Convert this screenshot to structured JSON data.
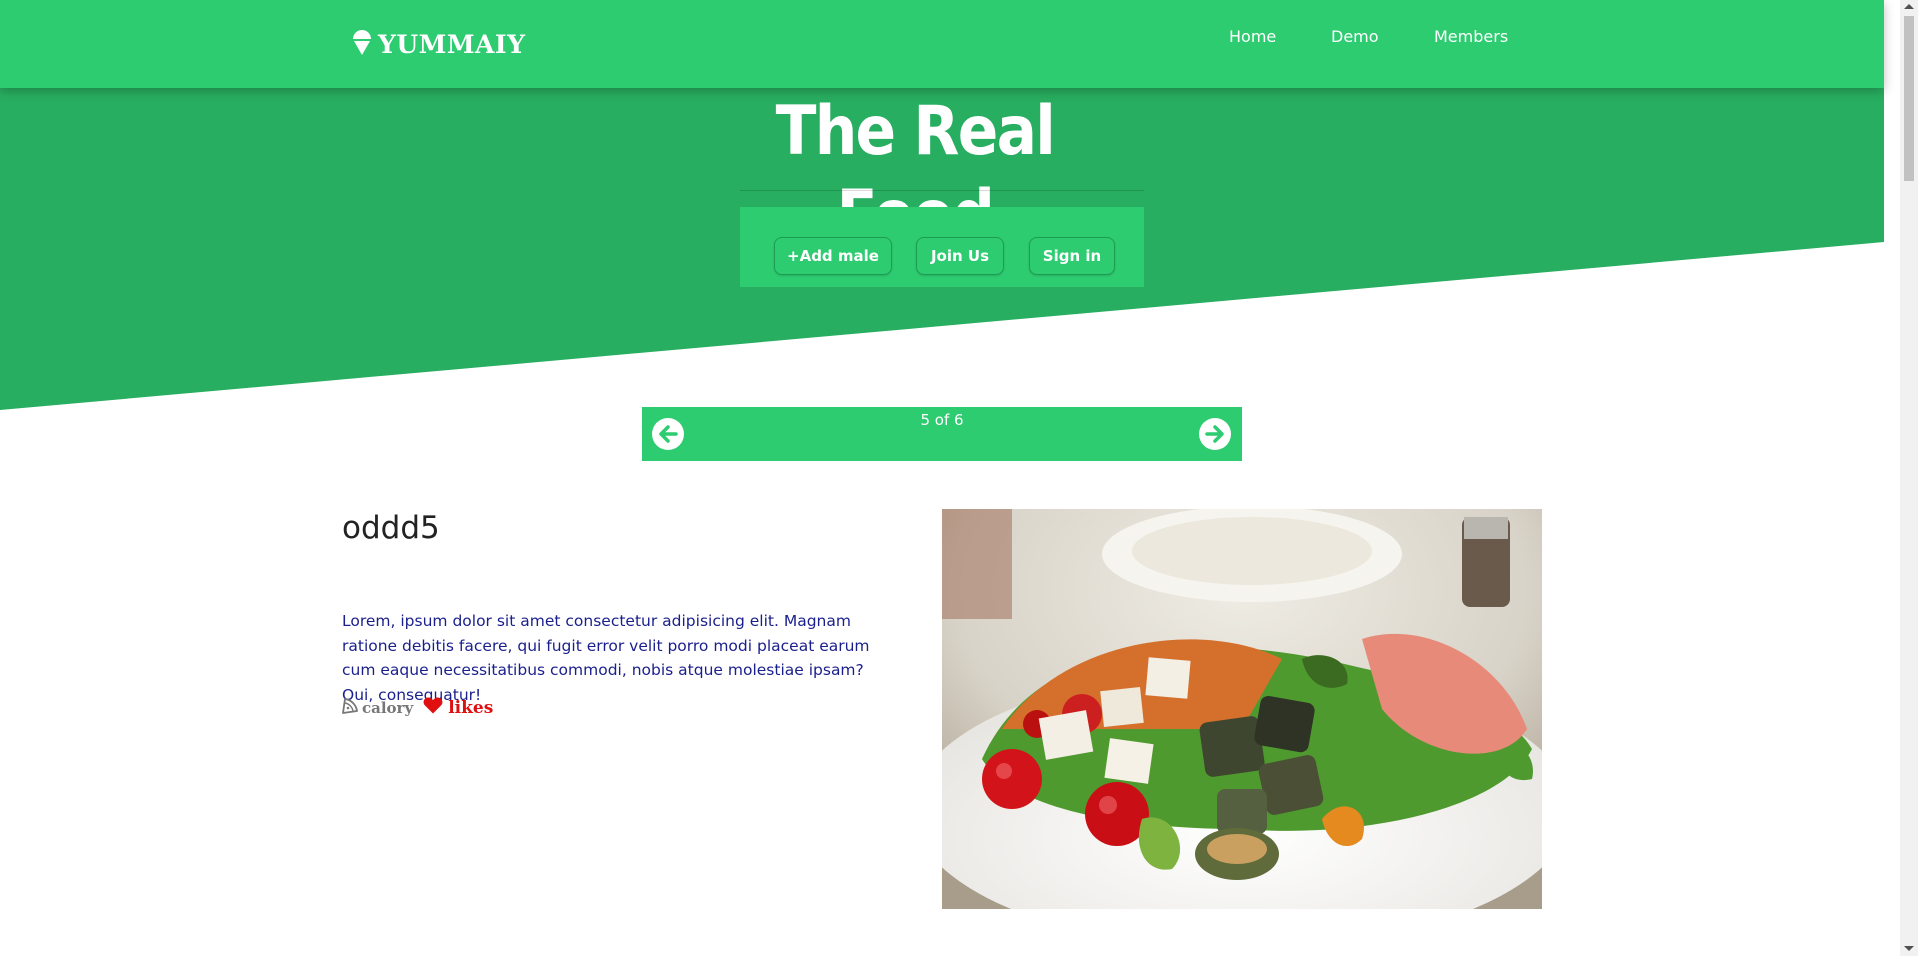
{
  "brand": {
    "name": "YUMMAIY",
    "icon": "ice-cream-icon"
  },
  "nav": {
    "items": [
      {
        "label": "Home"
      },
      {
        "label": "Demo"
      },
      {
        "label": "Members"
      }
    ]
  },
  "hero": {
    "title": "The Real Food",
    "buttons": [
      {
        "label": "+Add male"
      },
      {
        "label": "Join Us"
      },
      {
        "label": "Sign in"
      }
    ]
  },
  "pager": {
    "current": 5,
    "total": 6,
    "text": "5 of 6",
    "prev_icon": "arrow-left-circle-icon",
    "next_icon": "arrow-right-circle-icon"
  },
  "recipe": {
    "title": "oddd5",
    "description": "Lorem, ipsum dolor sit amet consectetur adipisicing elit. Magnam ratione debitis facere, qui fugit error velit porro modi placeat earum cum eaque necessitatibus commodi, nobis atque molestiae ipsam? Qui, consequatur!",
    "calory_label": "calory",
    "likes_label": "likes",
    "calory_icon": "pizza-slice-icon",
    "likes_icon": "heart-icon"
  },
  "colors": {
    "primary": "#2ecc71",
    "primary_dark": "#28ae60",
    "likes": "#e01010",
    "description": "#1a1f8c"
  }
}
